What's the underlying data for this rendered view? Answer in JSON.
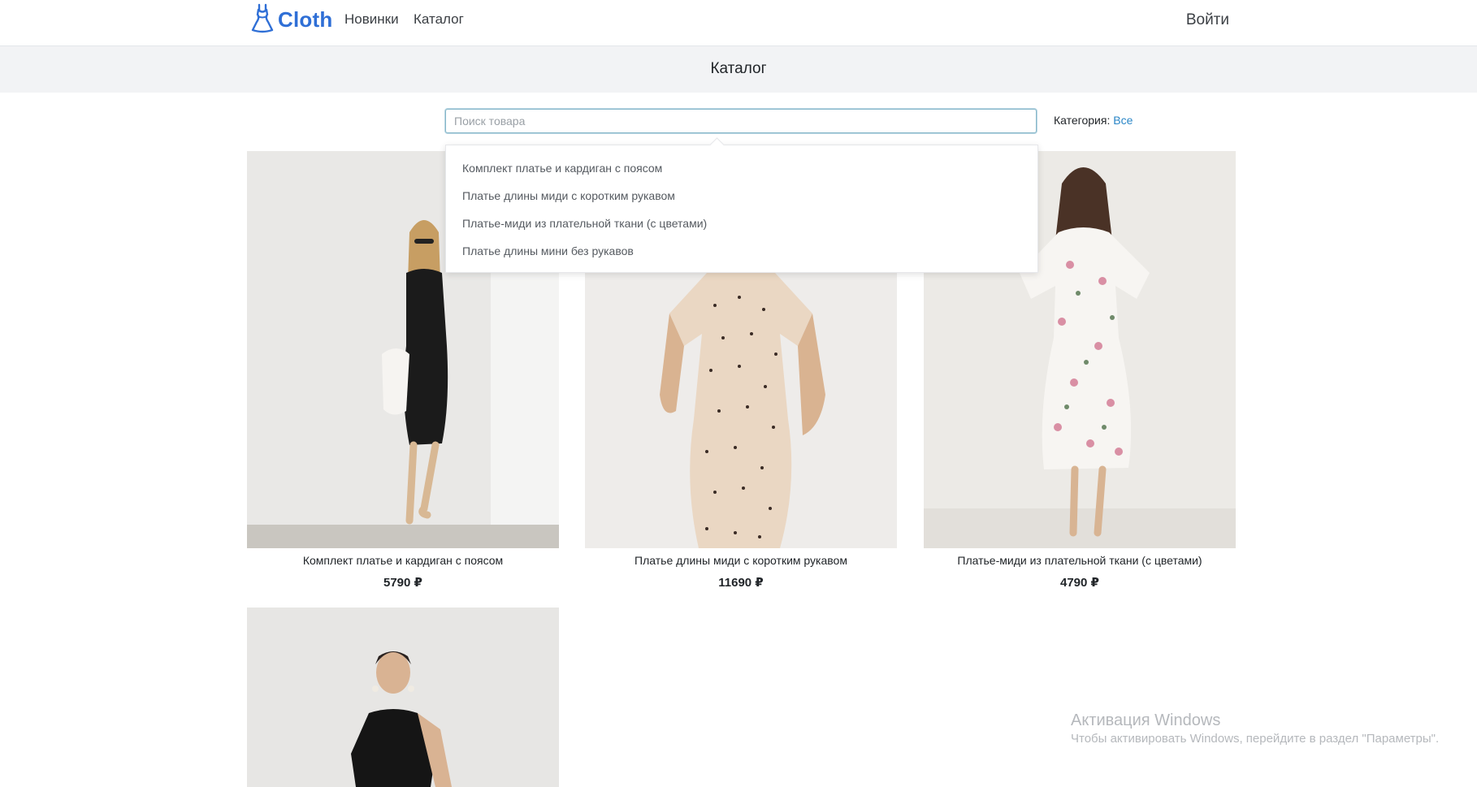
{
  "navbar": {
    "brand": "Cloth",
    "brand_icon": "dress-icon",
    "links": [
      "Новинки",
      "Каталог"
    ],
    "login": "Войти",
    "accent": "#2f6fd6"
  },
  "page": {
    "title": "Каталог"
  },
  "search": {
    "placeholder": "Поиск товара",
    "value": "",
    "suggestions": [
      "Комплект платье и кардиган с поясом",
      "Платье длины миди с коротким рукавом",
      "Платье-миди из плательной ткани (с цветами)",
      "Платье длины мини без рукавов"
    ]
  },
  "category": {
    "label": "Категория:",
    "value": "Все"
  },
  "products": [
    {
      "name": "Комплект платье и кардиган с поясом",
      "price": "5790 ₽"
    },
    {
      "name": "Платье длины миди с коротким рукавом",
      "price": "11690 ₽"
    },
    {
      "name": "Платье-миди из плательной ткани (с цветами)",
      "price": "4790 ₽"
    },
    {
      "name": "",
      "price": ""
    }
  ],
  "watermark": {
    "title": "Активация Windows",
    "subtitle": "Чтобы активировать Windows, перейдите в раздел \"Параметры\"."
  }
}
